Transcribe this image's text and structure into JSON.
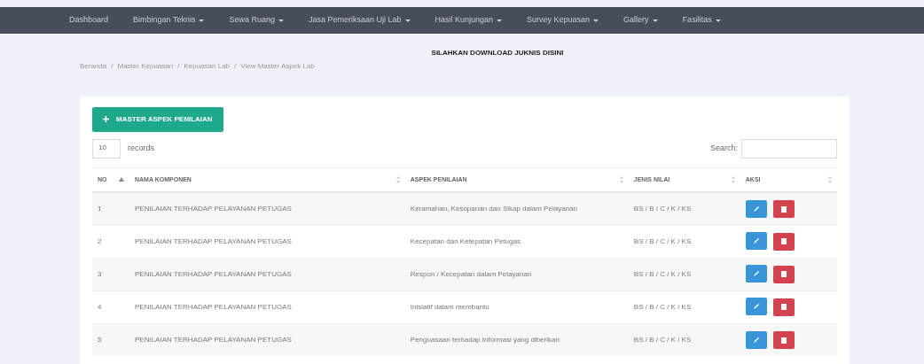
{
  "navbar": {
    "items": [
      {
        "label": "Dashboard",
        "dropdown": false
      },
      {
        "label": "Bimbingan Teknis",
        "dropdown": true
      },
      {
        "label": "Sewa Ruang",
        "dropdown": true
      },
      {
        "label": "Jasa Pemeriksaan Uji Lab",
        "dropdown": true
      },
      {
        "label": "Hasil Kunjungan",
        "dropdown": true
      },
      {
        "label": "Survey Kepuasan",
        "dropdown": true
      },
      {
        "label": "Gallery",
        "dropdown": true
      },
      {
        "label": "Fasilitas",
        "dropdown": true
      }
    ]
  },
  "download_link": "SILAHKAN DOWNLOAD JUKNIS DISINI",
  "breadcrumb_separator": "/",
  "breadcrumb": [
    "Beranda",
    "Master Kepuasan",
    "Kepuasan Lab",
    "View Master Aspek Lab"
  ],
  "add_button": "MASTER ASPEK PENILAIAN",
  "length": {
    "value": "10",
    "label": "records"
  },
  "search": {
    "label": "Search:"
  },
  "table": {
    "columns": [
      {
        "label": "NO",
        "sorted": true
      },
      {
        "label": "NAMA KOMPONEN",
        "sorted": false
      },
      {
        "label": "ASPEK PENILAIAN",
        "sorted": false
      },
      {
        "label": "JENIS NILAI",
        "sorted": false
      },
      {
        "label": "AKSI",
        "sorted": false
      }
    ],
    "rows": [
      {
        "no": "1",
        "komponen": "PENILAIAN TERHADAP PELAYANAN PETUGAS",
        "aspek": "Keramahan, Kesopanan dan Sikap dalam Pelayanan",
        "jenis": "BS / B / C / K / KS"
      },
      {
        "no": "2",
        "komponen": "PENILAIAN TERHADAP PELAYANAN PETUGAS",
        "aspek": "Kecepatan dan Ketepatan Petugas",
        "jenis": "BS / B / C / K / KS"
      },
      {
        "no": "3",
        "komponen": "PENILAIAN TERHADAP PELAYANAN PETUGAS",
        "aspek": "Respon / Kecepatan dalam Pelayanan",
        "jenis": "BS / B / C / K / KS"
      },
      {
        "no": "4",
        "komponen": "PENILAIAN TERHADAP PELAYANAN PETUGAS",
        "aspek": "Inisiatif dalam membantu",
        "jenis": "BS / B / C / K / KS"
      },
      {
        "no": "5",
        "komponen": "PENILAIAN TERHADAP PELAYANAN PETUGAS",
        "aspek": "Penguasaan terhadap Informasi yang diberikan",
        "jenis": "BS / B / C / K / KS"
      }
    ]
  }
}
